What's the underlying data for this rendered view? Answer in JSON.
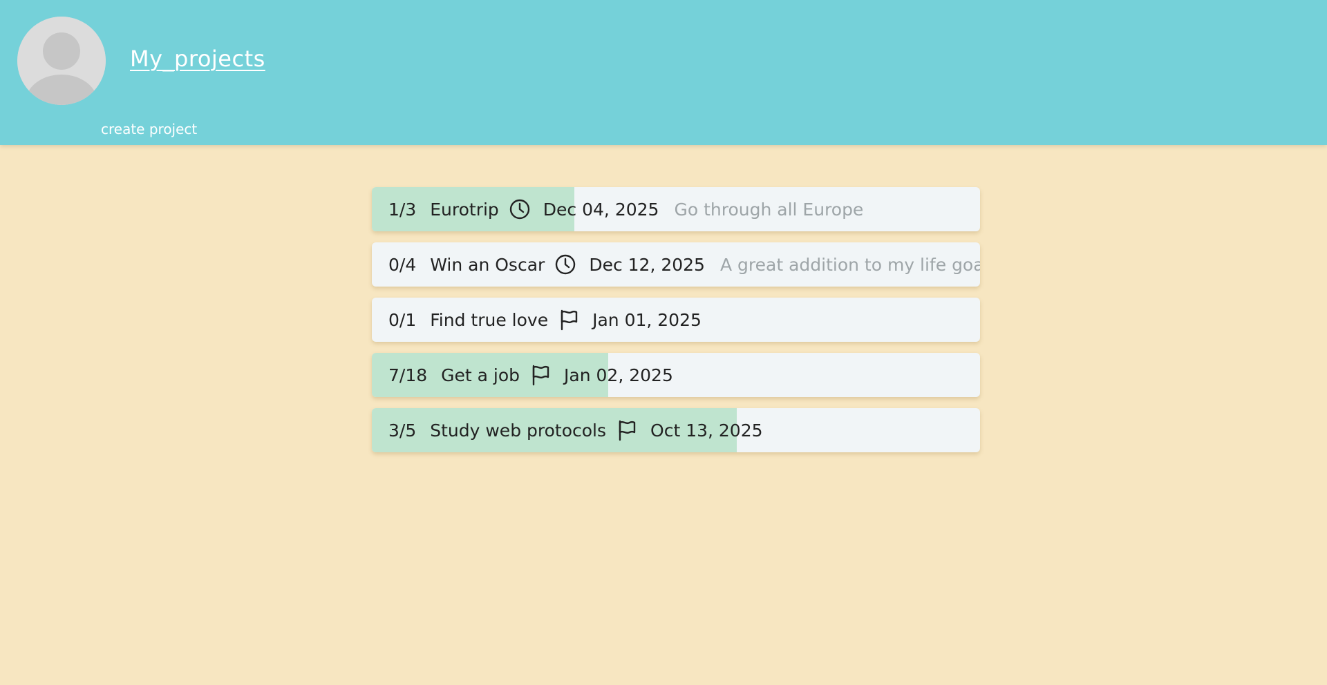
{
  "header": {
    "title": "My_projects",
    "create_label": "create project"
  },
  "colors": {
    "header_bg": "#75d1d9",
    "page_bg": "#f7e6c1",
    "row_bg": "#f1f5f7",
    "progress_fill": "#bfe4cf",
    "description_text": "#9ea5a8"
  },
  "projects": [
    {
      "count": "1/3",
      "name": "Eurotrip",
      "icon": "clock-icon",
      "date": "Dec 04, 2025",
      "description": "Go through all Europe",
      "progress": 0.333
    },
    {
      "count": "0/4",
      "name": "Win an Oscar",
      "icon": "clock-icon",
      "date": "Dec 12, 2025",
      "description": "A great addition to my life goals.",
      "progress": 0
    },
    {
      "count": "0/1",
      "name": "Find true love",
      "icon": "flag-icon",
      "date": "Jan 01, 2025",
      "description": "",
      "progress": 0
    },
    {
      "count": "7/18",
      "name": "Get a job",
      "icon": "flag-icon",
      "date": "Jan 02, 2025",
      "description": "",
      "progress": 0.389
    },
    {
      "count": "3/5",
      "name": "Study web protocols",
      "icon": "flag-icon",
      "date": "Oct 13, 2025",
      "description": "",
      "progress": 0.6
    }
  ]
}
